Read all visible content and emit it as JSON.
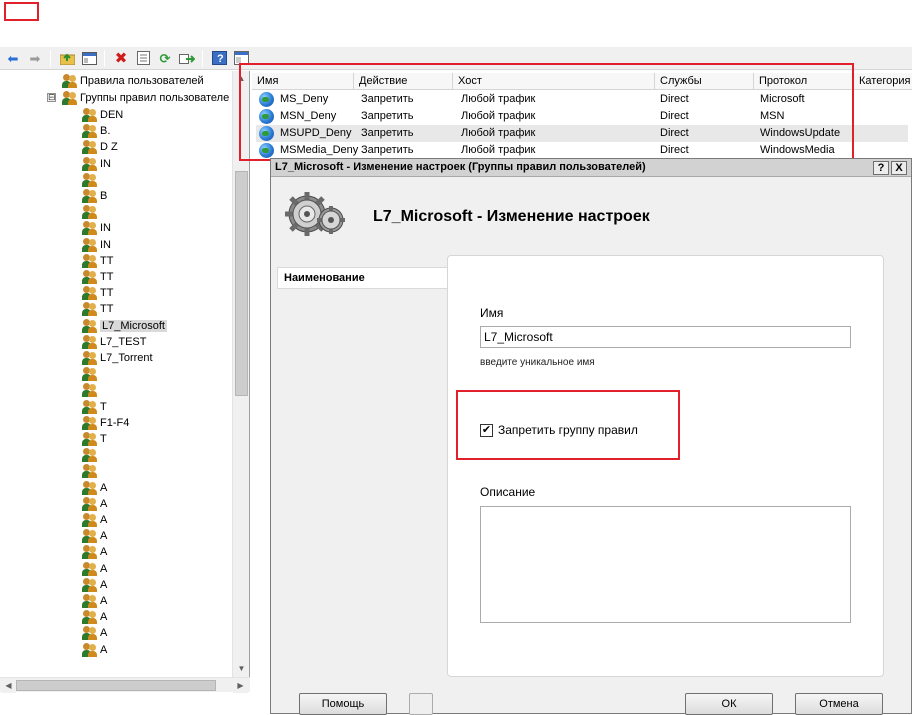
{
  "toolbar": {
    "icons": [
      "back-arrow-icon",
      "forward-arrow-icon",
      "folder-up-icon",
      "properties-icon",
      "delete-icon",
      "export-list-icon",
      "refresh-icon",
      "go-icon",
      "help-icon",
      "view-icon"
    ]
  },
  "tree": {
    "users_rules_label": "Правила пользователей",
    "groups_label": "Группы правил пользователе",
    "expander_symbol": "⊟",
    "partial_items": [
      "DEN",
      "B.",
      "D Z",
      "IN",
      "",
      "B",
      "",
      "IN",
      "IN",
      "TT",
      "TT",
      "TT",
      "TT"
    ],
    "items": [
      {
        "label": "L7_Microsoft",
        "selected": true
      },
      {
        "label": "L7_TEST",
        "selected": false
      },
      {
        "label": "L7_Torrent",
        "selected": false
      }
    ],
    "lower_partial": [
      "",
      "",
      "T",
      "F1-F4",
      "T",
      "",
      "",
      "A",
      "A",
      "A",
      "A",
      "A",
      "A",
      "A",
      "A",
      "A",
      "A",
      "A"
    ]
  },
  "grid": {
    "columns": [
      "Имя",
      "Действие",
      "Хост",
      "Службы",
      "Протокол",
      "Категория"
    ],
    "rows": [
      {
        "name": "MS_Deny",
        "action": "Запретить",
        "host": "Любой трафик",
        "service": "Direct",
        "protocol": "Microsoft"
      },
      {
        "name": "MSN_Deny",
        "action": "Запретить",
        "host": "Любой трафик",
        "service": "Direct",
        "protocol": "MSN"
      },
      {
        "name": "MSUPD_Deny",
        "action": "Запретить",
        "host": "Любой трафик",
        "service": "Direct",
        "protocol": "WindowsUpdate"
      },
      {
        "name": "MSMedia_Deny",
        "action": "Запретить",
        "host": "Любой трафик",
        "service": "Direct",
        "protocol": "WindowsMedia"
      }
    ]
  },
  "dialog": {
    "title": "L7_Microsoft - Изменение настроек (Группы правил пользователей)",
    "help_btn": "?",
    "close_btn": "X",
    "heading": "L7_Microsoft - Изменение настроек",
    "nav_tab": "Наименование",
    "name_label": "Имя",
    "name_value": "L7_Microsoft",
    "name_hint": "введите уникальное имя",
    "deny_checkbox_label": "Запретить группу правил",
    "deny_checked": true,
    "check_mark": "✔",
    "description_label": "Описание",
    "description_value": "",
    "help_button": "Помощь",
    "ok_button": "ОК",
    "cancel_button": "Отмена"
  },
  "colors": {
    "highlight_red": "#e0202a",
    "selection_gray": "#d9d9d9"
  }
}
